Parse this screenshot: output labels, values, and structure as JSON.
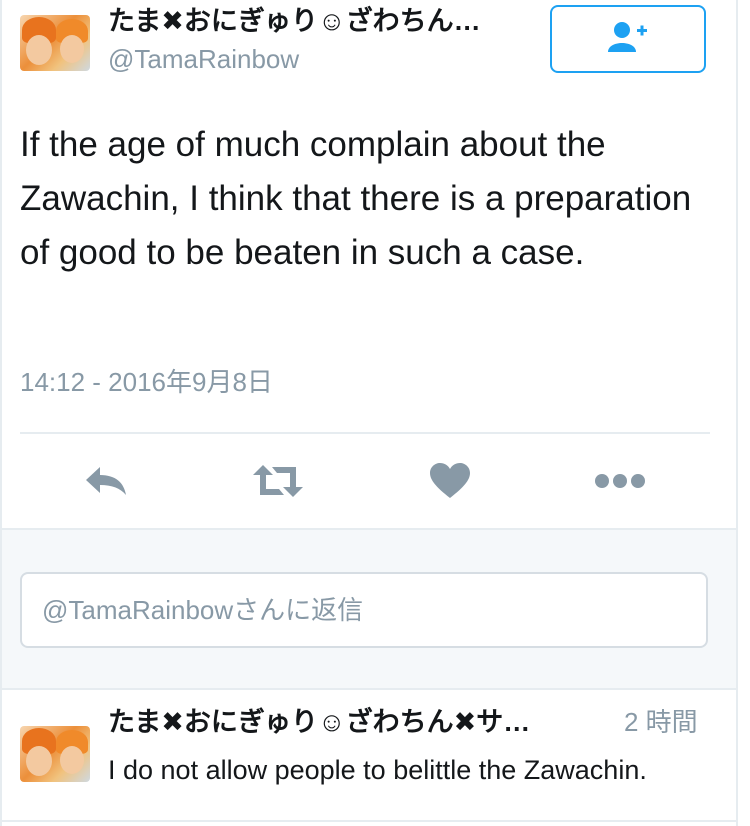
{
  "tweet": {
    "display_name": "たま✖おにぎゅり☺ざわちん…",
    "handle": "@TamaRainbow",
    "text": "If the age of much complain about the Zawachin, I think that there is a preparation of good to be beaten in such a case.",
    "timestamp": "14:12 - 2016年9月8日",
    "follow_icon": "add-user-icon"
  },
  "actions": {
    "reply_icon": "reply-icon",
    "retweet_icon": "retweet-icon",
    "like_icon": "heart-icon",
    "more_icon": "more-icon"
  },
  "reply_box": {
    "placeholder": "@TamaRainbowさんに返信"
  },
  "reply": {
    "display_name": "たま✖おにぎゅり☺ざわちん✖サ…",
    "time": "2 時間",
    "text": "I do not allow people to belittle the Zawachin."
  },
  "colors": {
    "accent": "#1da1f2",
    "icon": "#8899a6",
    "text": "#14171a",
    "muted": "#8899a6"
  }
}
